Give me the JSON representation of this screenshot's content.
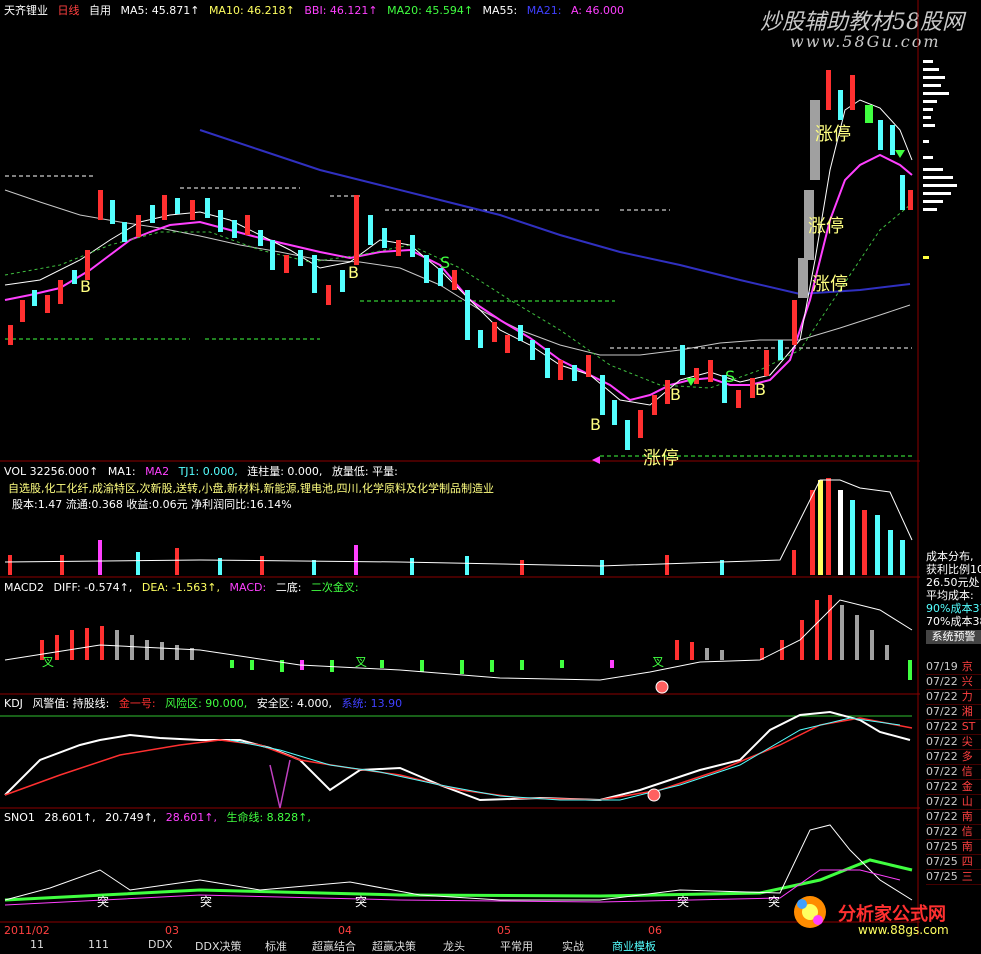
{
  "watermark": {
    "line1": "炒股辅助教材58股网",
    "line2": "www.58Gu.com"
  },
  "watermark2": {
    "line1": "分析家公式网",
    "line2": "www.88gs.com"
  },
  "main_header": {
    "stock": "天齐锂业",
    "period": "日线",
    "custom": "自用",
    "ma5": "MA5: 45.871↑",
    "ma10": "MA10: 46.218↑",
    "bbi": "BBI: 46.121↑",
    "ma20": "MA20: 45.594↑",
    "ma55": "MA55:",
    "ma_extra": "MA21:",
    "a_val": "A: 46.000"
  },
  "main_labels": {
    "zhangting": "涨停",
    "b": "B",
    "s": "S"
  },
  "vol_header": {
    "vol": "VOL 32256.000↑",
    "ma1": "MA1:",
    "ma2": "MA2",
    "tj1": "TJ1: 0.000,",
    "lianzhu": "连柱量: 0.000,",
    "fangliang": "放量低: 平量:"
  },
  "vol_info": {
    "concepts": "自选股,化工化纤,成渝特区,次新股,送转,小盘,新材料,新能源,锂电池,四川,化学原料及化学制品制造业",
    "stats": "股本:1.47   流通:0.368  收益:0.06元   净利润同比:16.14%"
  },
  "macd_header": {
    "name": "MACD2",
    "diff": "DIFF: -0.574↑,",
    "dea": "DEA: -1.563↑,",
    "macd": "MACD:",
    "erdi": "二底:",
    "erci": "二次金叉:",
    "cha": "叉"
  },
  "kdj_header": {
    "name": "KDJ",
    "fengjing": "风警值: 持股线:",
    "jinyihao": "金一号:",
    "fengxian": "风险区: 90.000,",
    "anquan": "安全区: 4.000,",
    "last": "系统: 13.90"
  },
  "sn_header": {
    "name": "SNO1",
    "v1": "28.601↑,",
    "v2": "20.749↑,",
    "v3": "28.601↑,",
    "life": "生命线: 8.828↑,",
    "tu": "突"
  },
  "x_axis": {
    "labels": [
      "2011/02",
      "03",
      "04",
      "05",
      "06"
    ]
  },
  "bottom_tabs": [
    "11",
    "111",
    "DDX",
    "DDX决策",
    "标准",
    "超赢结合",
    "超赢决策",
    "龙头",
    "平常用",
    "实战",
    "商业模板"
  ],
  "side_panel": {
    "cost_title": "成本分布,",
    "profit": "获利比例10",
    "price_at": "26.50元处",
    "avg_cost": "平均成本:",
    "cost90": "90%成本37",
    "cost70": "70%成本38",
    "sys_tab": "系统预警",
    "alerts": [
      {
        "date": "07/19",
        "name": "京"
      },
      {
        "date": "07/22",
        "name": "兴"
      },
      {
        "date": "07/22",
        "name": "力"
      },
      {
        "date": "07/22",
        "name": "湘"
      },
      {
        "date": "07/22",
        "name": "ST"
      },
      {
        "date": "07/22",
        "name": "尖"
      },
      {
        "date": "07/22",
        "name": "多"
      },
      {
        "date": "07/22",
        "name": "信"
      },
      {
        "date": "07/22",
        "name": "金"
      },
      {
        "date": "07/22",
        "name": "山"
      },
      {
        "date": "07/22",
        "name": "南"
      },
      {
        "date": "07/22",
        "name": "信"
      },
      {
        "date": "07/25",
        "name": "南"
      },
      {
        "date": "07/25",
        "name": "四"
      },
      {
        "date": "07/25",
        "name": "三"
      }
    ]
  },
  "colors": {
    "up": "#ff3030",
    "down": "#54ffff",
    "ma_pink": "#ff40ff",
    "ma_white": "#ffffff",
    "ma_blue": "#3030c0",
    "label_yellow": "#ffff80",
    "green": "#40ff40"
  }
}
